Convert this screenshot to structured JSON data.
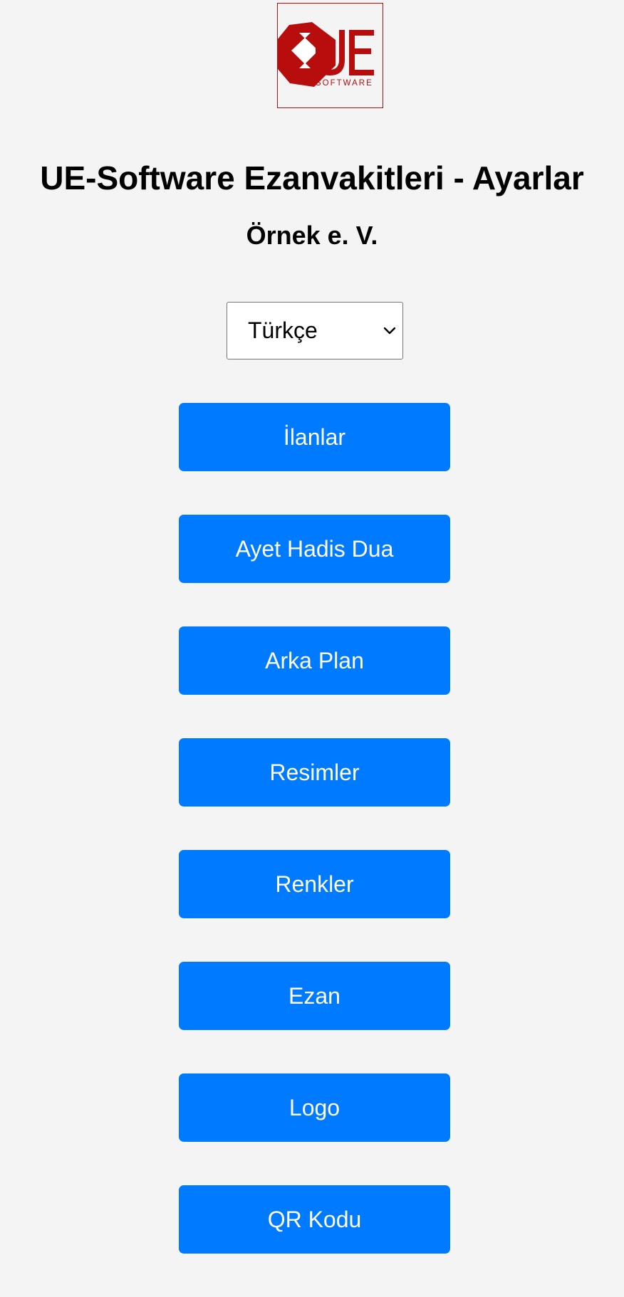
{
  "logo": {
    "letters": "UE",
    "tagline": "SOFTWARE",
    "brand_color": "#b70d0d"
  },
  "header": {
    "title": "UE-Software Ezanvakitleri - Ayarlar",
    "organization": "Örnek e. V."
  },
  "language_select": {
    "selected": "Türkçe",
    "icon": "chevron-down-icon"
  },
  "menu": {
    "button_color": "#007bff",
    "items": [
      {
        "label": "İlanlar"
      },
      {
        "label": "Ayet Hadis Dua"
      },
      {
        "label": "Arka Plan"
      },
      {
        "label": "Resimler"
      },
      {
        "label": "Renkler"
      },
      {
        "label": "Ezan"
      },
      {
        "label": "Logo"
      },
      {
        "label": "QR Kodu"
      }
    ]
  }
}
